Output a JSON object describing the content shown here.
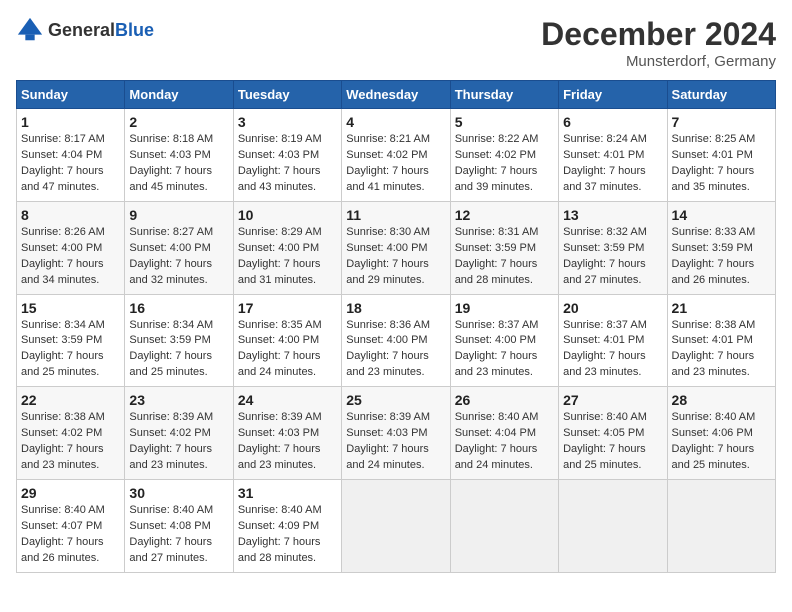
{
  "logo": {
    "general": "General",
    "blue": "Blue"
  },
  "title": "December 2024",
  "location": "Munsterdorf, Germany",
  "days_of_week": [
    "Sunday",
    "Monday",
    "Tuesday",
    "Wednesday",
    "Thursday",
    "Friday",
    "Saturday"
  ],
  "weeks": [
    [
      {
        "day": "1",
        "sunrise": "8:17 AM",
        "sunset": "4:04 PM",
        "daylight": "7 hours and 47 minutes."
      },
      {
        "day": "2",
        "sunrise": "8:18 AM",
        "sunset": "4:03 PM",
        "daylight": "7 hours and 45 minutes."
      },
      {
        "day": "3",
        "sunrise": "8:19 AM",
        "sunset": "4:03 PM",
        "daylight": "7 hours and 43 minutes."
      },
      {
        "day": "4",
        "sunrise": "8:21 AM",
        "sunset": "4:02 PM",
        "daylight": "7 hours and 41 minutes."
      },
      {
        "day": "5",
        "sunrise": "8:22 AM",
        "sunset": "4:02 PM",
        "daylight": "7 hours and 39 minutes."
      },
      {
        "day": "6",
        "sunrise": "8:24 AM",
        "sunset": "4:01 PM",
        "daylight": "7 hours and 37 minutes."
      },
      {
        "day": "7",
        "sunrise": "8:25 AM",
        "sunset": "4:01 PM",
        "daylight": "7 hours and 35 minutes."
      }
    ],
    [
      {
        "day": "8",
        "sunrise": "8:26 AM",
        "sunset": "4:00 PM",
        "daylight": "7 hours and 34 minutes."
      },
      {
        "day": "9",
        "sunrise": "8:27 AM",
        "sunset": "4:00 PM",
        "daylight": "7 hours and 32 minutes."
      },
      {
        "day": "10",
        "sunrise": "8:29 AM",
        "sunset": "4:00 PM",
        "daylight": "7 hours and 31 minutes."
      },
      {
        "day": "11",
        "sunrise": "8:30 AM",
        "sunset": "4:00 PM",
        "daylight": "7 hours and 29 minutes."
      },
      {
        "day": "12",
        "sunrise": "8:31 AM",
        "sunset": "3:59 PM",
        "daylight": "7 hours and 28 minutes."
      },
      {
        "day": "13",
        "sunrise": "8:32 AM",
        "sunset": "3:59 PM",
        "daylight": "7 hours and 27 minutes."
      },
      {
        "day": "14",
        "sunrise": "8:33 AM",
        "sunset": "3:59 PM",
        "daylight": "7 hours and 26 minutes."
      }
    ],
    [
      {
        "day": "15",
        "sunrise": "8:34 AM",
        "sunset": "3:59 PM",
        "daylight": "7 hours and 25 minutes."
      },
      {
        "day": "16",
        "sunrise": "8:34 AM",
        "sunset": "3:59 PM",
        "daylight": "7 hours and 25 minutes."
      },
      {
        "day": "17",
        "sunrise": "8:35 AM",
        "sunset": "4:00 PM",
        "daylight": "7 hours and 24 minutes."
      },
      {
        "day": "18",
        "sunrise": "8:36 AM",
        "sunset": "4:00 PM",
        "daylight": "7 hours and 23 minutes."
      },
      {
        "day": "19",
        "sunrise": "8:37 AM",
        "sunset": "4:00 PM",
        "daylight": "7 hours and 23 minutes."
      },
      {
        "day": "20",
        "sunrise": "8:37 AM",
        "sunset": "4:01 PM",
        "daylight": "7 hours and 23 minutes."
      },
      {
        "day": "21",
        "sunrise": "8:38 AM",
        "sunset": "4:01 PM",
        "daylight": "7 hours and 23 minutes."
      }
    ],
    [
      {
        "day": "22",
        "sunrise": "8:38 AM",
        "sunset": "4:02 PM",
        "daylight": "7 hours and 23 minutes."
      },
      {
        "day": "23",
        "sunrise": "8:39 AM",
        "sunset": "4:02 PM",
        "daylight": "7 hours and 23 minutes."
      },
      {
        "day": "24",
        "sunrise": "8:39 AM",
        "sunset": "4:03 PM",
        "daylight": "7 hours and 23 minutes."
      },
      {
        "day": "25",
        "sunrise": "8:39 AM",
        "sunset": "4:03 PM",
        "daylight": "7 hours and 24 minutes."
      },
      {
        "day": "26",
        "sunrise": "8:40 AM",
        "sunset": "4:04 PM",
        "daylight": "7 hours and 24 minutes."
      },
      {
        "day": "27",
        "sunrise": "8:40 AM",
        "sunset": "4:05 PM",
        "daylight": "7 hours and 25 minutes."
      },
      {
        "day": "28",
        "sunrise": "8:40 AM",
        "sunset": "4:06 PM",
        "daylight": "7 hours and 25 minutes."
      }
    ],
    [
      {
        "day": "29",
        "sunrise": "8:40 AM",
        "sunset": "4:07 PM",
        "daylight": "7 hours and 26 minutes."
      },
      {
        "day": "30",
        "sunrise": "8:40 AM",
        "sunset": "4:08 PM",
        "daylight": "7 hours and 27 minutes."
      },
      {
        "day": "31",
        "sunrise": "8:40 AM",
        "sunset": "4:09 PM",
        "daylight": "7 hours and 28 minutes."
      },
      null,
      null,
      null,
      null
    ]
  ]
}
